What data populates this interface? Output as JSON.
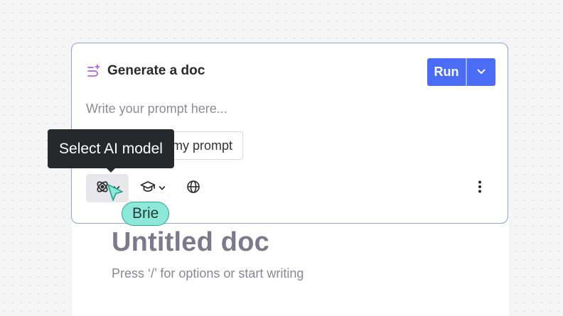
{
  "document": {
    "title": "Untitled doc",
    "hint": "Press ‘/’ for options or start writing"
  },
  "ai_block": {
    "title": "Generate a doc",
    "icon": "sparkle-flow-icon",
    "run_label": "Run",
    "run_menu_icon": "chevron-down-icon",
    "prompt_placeholder": "Write your prompt here...",
    "chip_label": "my prompt",
    "toolbar": {
      "model_icon": "orbit-icon",
      "education_icon": "graduation-cap-icon",
      "web_icon": "globe-icon",
      "more_icon": "more-vertical-icon"
    },
    "colors": {
      "accent": "#4a6cf7",
      "border": "#8ea1d8",
      "icon_purple": "#b35fe0"
    }
  },
  "tooltip": {
    "text": "Select AI model"
  },
  "collaborator": {
    "name": "Brie",
    "color": "#8ee8d9"
  }
}
